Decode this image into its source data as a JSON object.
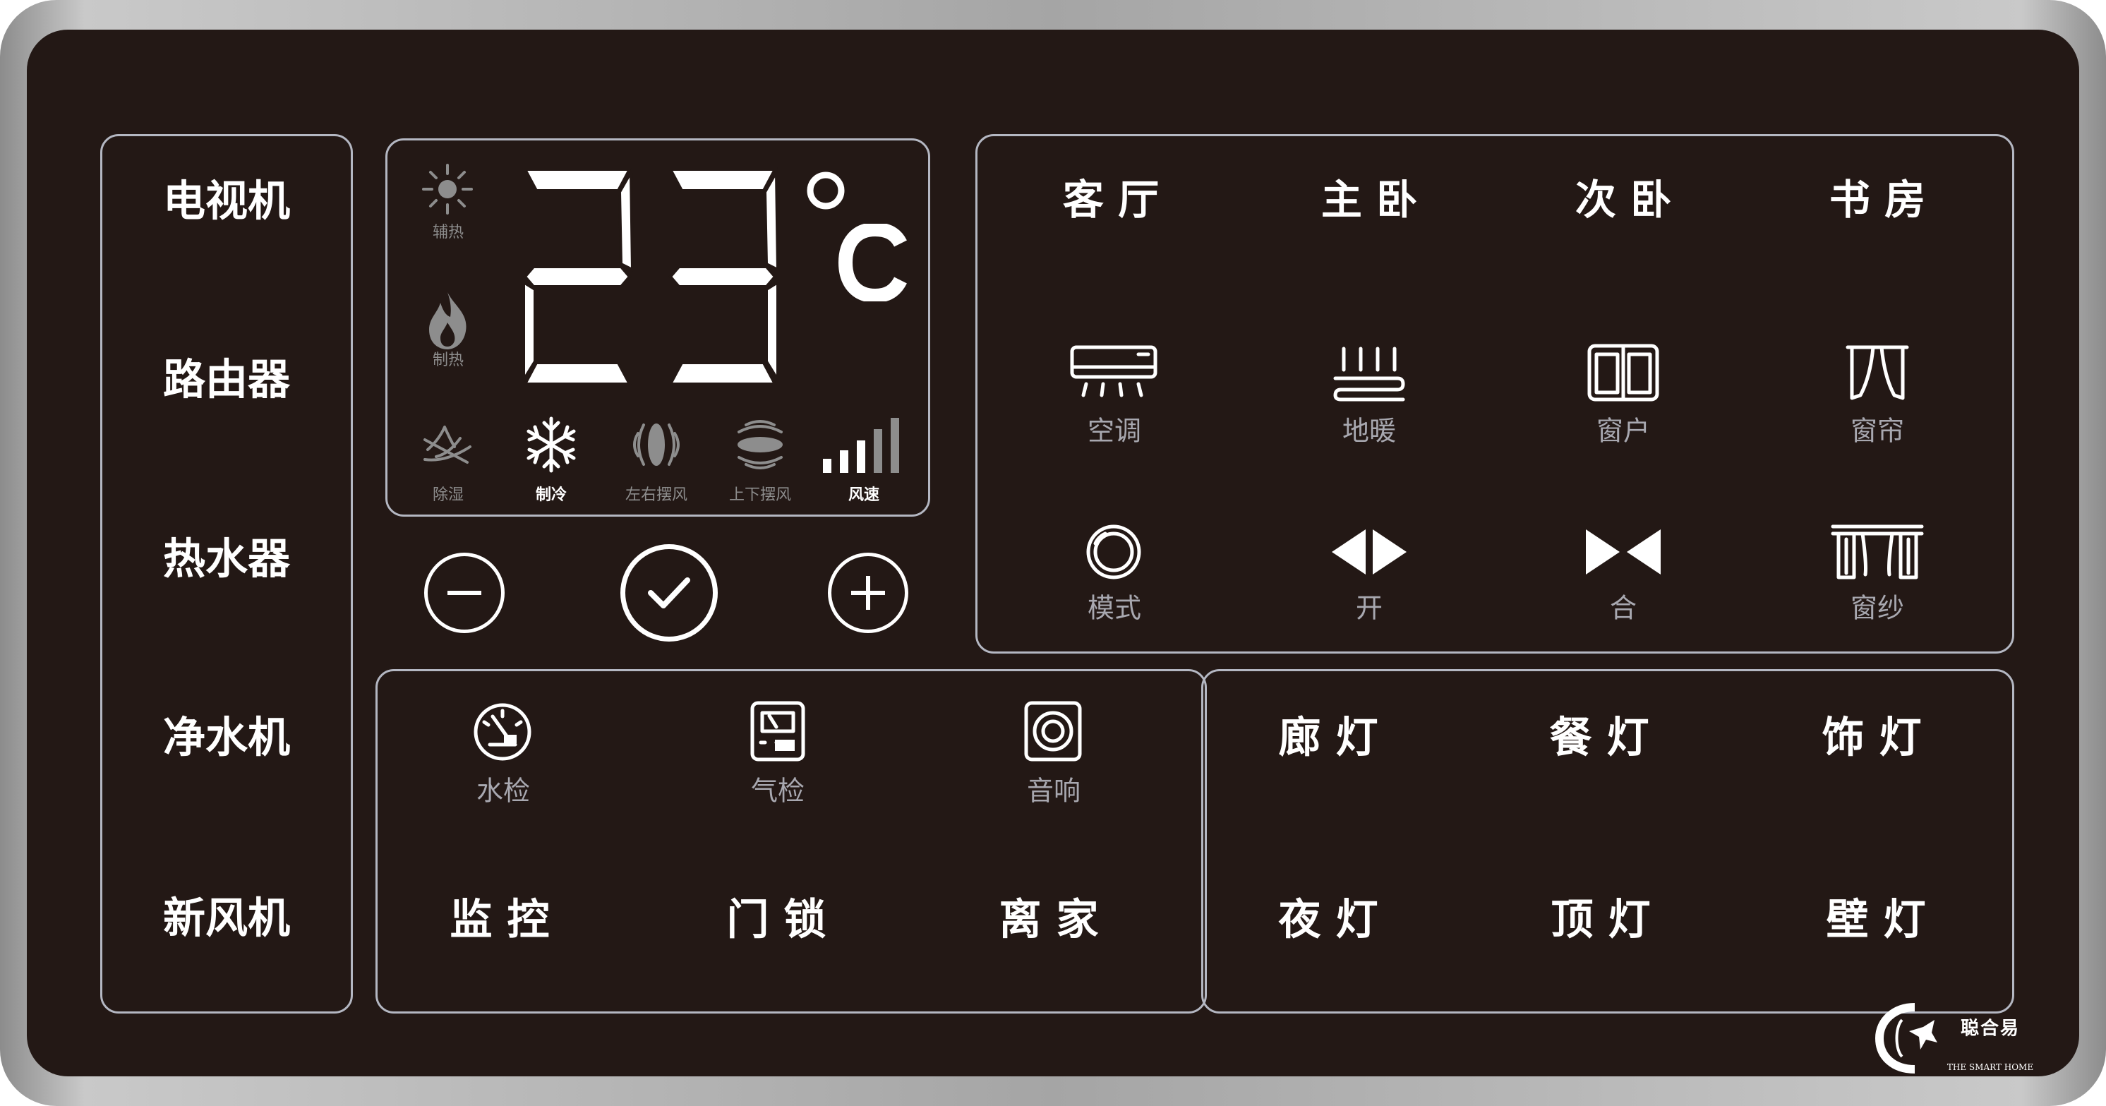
{
  "appliances": {
    "items": [
      "电视机",
      "路由器",
      "热水器",
      "净水机",
      "新风机"
    ]
  },
  "thermostat": {
    "temperature": "23",
    "unit": "°C",
    "indicators": {
      "aux_heat": "辅热",
      "heat": "制热",
      "dehumidify": "除湿",
      "cool": "制冷",
      "swing_lr": "左右摆风",
      "swing_ud": "上下摆风",
      "fan_speed": "风速"
    },
    "active": [
      "制冷",
      "风速"
    ]
  },
  "controls": {
    "minus": "minus",
    "confirm": "confirm",
    "plus": "plus"
  },
  "rooms": {
    "tabs": [
      "客 厅",
      "主 卧",
      "次 卧",
      "书 房"
    ],
    "row1": [
      "空调",
      "地暖",
      "窗户",
      "窗帘"
    ],
    "row2": [
      "模式",
      "开",
      "合",
      "窗纱"
    ]
  },
  "security": {
    "sensors": [
      "水检",
      "气检",
      "音响"
    ],
    "actions": [
      "监 控",
      "门 锁",
      "离 家"
    ]
  },
  "lights": {
    "row1": [
      "廊 灯",
      "餐 灯",
      "饰 灯"
    ],
    "row2": [
      "夜 灯",
      "顶 灯",
      "壁 灯"
    ]
  },
  "brand": {
    "tagline": "THE SMART HOME",
    "mark": "聪合易"
  },
  "colors": {
    "panel": "#231815",
    "frame": "#a5a5a5",
    "outline": "#b4b7c2",
    "active": "#ffffff",
    "inactive": "#8d8d8d"
  }
}
